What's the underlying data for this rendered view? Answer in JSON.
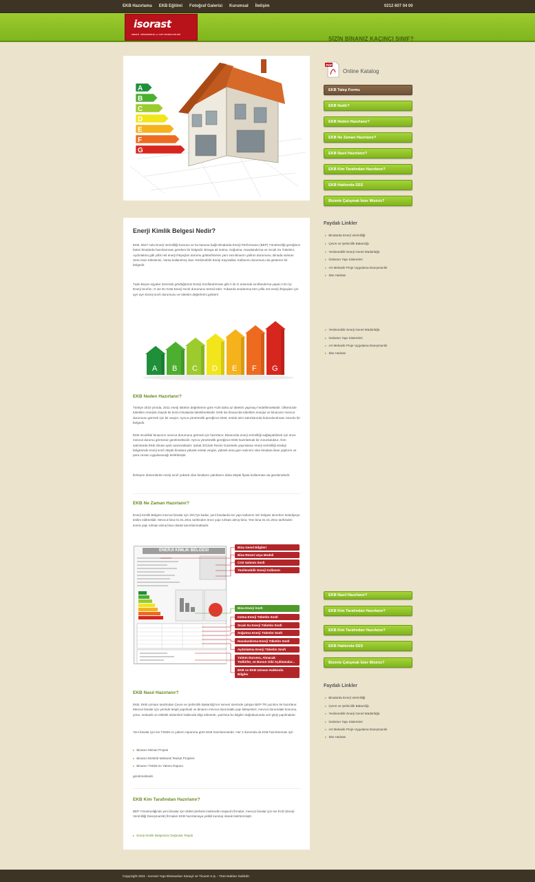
{
  "topbar": {
    "nav": [
      "EKB Hazırlama",
      "EKB Eğitimi",
      "Fotoğraf Galerisi",
      "Kurumsal",
      "İletişim"
    ],
    "phone": "0212 607 04 00"
  },
  "header": {
    "logo": "isorast",
    "logo_sub": "ENERJİ - MÜHENDİSLİK ve YAPI TEKNOLOJİLERİ",
    "tagline": "SİZİN BİNANIZ KAÇINCI SINIF?"
  },
  "hero": {
    "classes": [
      "A",
      "B",
      "C",
      "D",
      "E",
      "F",
      "G"
    ],
    "colors": [
      "#1f8f3a",
      "#4caf2f",
      "#9ccb2e",
      "#f2e51b",
      "#f5b21b",
      "#ee6a1f",
      "#d7261e"
    ]
  },
  "article": {
    "title": "Enerji Kimlik Belgesi Nedir?",
    "p1": "EKB, 5627 nolu Enerji Verimliliği Kanunu ve bu kanuna bağlı Binalarda Enerji Performansı (BEP) Yönetmeliği gereğince bütün binalarda hazırlanması gereken bir belgedir. Binaya ait Isıtma, Soğutma, Havalandırma ve Sıcak Su Tüketimi, Aydınlatma gibi yıllık net enerji ihtiyaçları durumu gösterilmenin yanı sıra Binanın yalıtım durumunu, Binada salınan Sera Gazı tüketimini, Varsa kullanılmış olan Yenilenebilir Enerji Kaynakları Kullanımı durumunu da gösteren bir belgedir.",
    "p2": "Tıpkı Beyaz eşyalar üzerinde gördüğümüz Enerji Sınıflandırması gibi A ile G arasında sınıflandırma yapar.A En İyi Enerji Sınıfını; G ise En Kötü Enerji Sınıfı durumunu temsil eder. Yukarıda sıralanmış tüm yıllık net enerji ihtiyaçları için ayrı ayrı Enerji sınıfı durumunu ve tüketim değerlerini gösterir",
    "houses": [
      "A",
      "B",
      "C",
      "D",
      "E",
      "F",
      "G"
    ],
    "house_colors": [
      "#1f8f3a",
      "#4caf2f",
      "#9ccb2e",
      "#f2e51b",
      "#f5b21b",
      "#ee6a1f",
      "#d7261e"
    ],
    "s1_title": "EKB Neden Hazırlanır?",
    "s1_p1": "Türkiye 2023 yılında, 2011 enerji tüketim değerlerine göre %20 daha az tüketim yapmayı hedeflemektedir. Ülkemizde tüketilen enerjinin büyük bir kısmı binalarda tüketilmektedir. EKB ise binanızda tüketilen enerjiyi ve binanızın mevcut durumunu görmek için bir araçtır. Ayrıca yönetmelik gereğince EKB, emlak alım satımlarında bulundurulması zorunlu bir belgedir.",
    "s1_p2": "EKB öncelikle binanızın mevcut durumunu görmek için hazırlanır. Binanızda enerji verimliliği sağlayabilmek için önce mevcut durumu görmeniz gerekmektedir. Ayrıca yönetmelik gereğince EKB hazırlatmak bir zorunluluktur. Alım satımlarda EKB olması şartı aranmaktadır. Şubat 2012de Resmi Gazetede yayınlanan enerji verimliliği strateji belgesinde enerji sınıfı düşük binalara yüksek emlak vergisi, yüksek sera gazı salınımı olan binalara ilave yaptırım ve para cezası uygulanacağı belirtilmiştir.",
    "s1_p3": "İlerleyen dönemlerde enerji sınıfı yüksek olan binaların yakıtlarını daha düşük fiyata kullanması da gündemdedir.",
    "s2_title": "EKB Ne Zaman Hazırlanır?",
    "s2_p1": "Enerji Kimlik Belgesi mevcut binalar için 2017ye kadar, yeni binalarda ise yapı kullanım izin belgesi alınırken belediyeye teslim edilmelidir. Mevcut bina 01.01.2011 tarihinden önce yapı ruhsatı almış bina; Yeni bina 01.01.2011 tarihinden sonra yapı ruhsatı almış bina olarak tanımlanmaktadır.",
    "cert_title": "ENERJİ KİMLİK BELGESİ",
    "cert_labels": [
      "Bina Genel Bilgileri",
      "Bina Resmi veya Modeli",
      "CO2 Salınım Sınıfı",
      "Yenilenebilir Enerji Kullanım Oranı",
      "Bina Enerji Sınıfı",
      "Isıtma Enerji Tüketim Sınıfı",
      "Sıcak Su Enerji Tüketim Sınıfı",
      "Soğutma Enerji Tüketim Sınıfı",
      "Havalandırma Enerji Tüketim Sınıfı",
      "Aydınlatma Enerji Tüketim Sınıfı",
      "Yalıtım Durumu, Alınacak Tedbirler, ve Bunun Gibi Açıklamalar...",
      "EKB ve EKB Uzmanı Hakkında Bilgiler"
    ],
    "s3_title": "EKB Nasıl Hazırlanır?",
    "s3_p1": "EKB, EKB uzmanı tarafından Çevre ve Şehircilik Bakanlığı'nın serveri üzerinde çalışan BEP-TR yazılımı ile hazırlanır. Mevcut binalar için yerinde tespit yapılmalı ve binanın mevcut durumdaki yapı bileşenleri, mevcut durumdaki konumu, yönü, mekanik ve elektrik sistemleri hakkında bilgi edinerek, yazılıma bu bilgiler doğrultusunda veri girişi yapılmalıdır.",
    "s3_p2": "Yeni binalar için ise TS825 ısı yalıtım raporuna göre EKB hazırlanmalıdır. Her 2 durumda da EKB hazırlanması için",
    "s3_bullets": [
      "Binanın Mimari Projesi",
      "Binanın Elektrik-Mekanik Tesisat Projeleri",
      "Binanın TS825 Isı Yalıtım Raporu"
    ],
    "s3_p3": "gerekmektedir.",
    "s4_title": "EKB Kim Tarafından Hazırlanır?",
    "s4_p1": "BEP Yönetmeliğinde yeni binalar için SMM (serbest mühendis müşavir) firmalar; mevcut binalar için ise EVD (Enerji Verimliliği Danışmanlık) firmaları EKB hazırlamaya yetkili kuruluş olarak belirlenmiştir.",
    "s4_link": "Enerji Kimlik Belgenizin Doğruluk Tespiti"
  },
  "sidebar": {
    "catalog": "Online Katalog",
    "pdf": "PDF",
    "buttons": [
      "EKB Talep Formu",
      "EKB Nedir?",
      "EKB Neden Hazırlanır?",
      "EKB Ne Zaman Hazırlanır?",
      "EKB Nasıl Hazırlanır?",
      "EKB Kim Tarafından Hazırlanır?",
      "EKB Hakkında SSS",
      "Bizimle Çalışmak İster Misiniz?"
    ],
    "links_title": "Faydalı Linkler",
    "links": [
      "Binalarda Enerji Verimliliği",
      "Çevre ve Şehircilik Bakanlığı",
      "Yenilenebilir Enerji Genel Müdürlüğü",
      "İzobeton Yapı Sistemleri",
      "Art Mekanik Proje Uygulama Danışmanlık",
      "Site Haritası"
    ],
    "ghost_links": [
      "Yenilenebilir Enerji Genel Müdürlüğü",
      "İzobeton Yapı Sistemleri",
      "Art Mekanik Proje Uygulama Danışmanlık",
      "Site Haritası"
    ],
    "buttons2": [
      "EKB Nasıl Hazırlanır?",
      "EKB Kim Tarafından Hazırlanır?",
      "EKB Kim Tarafından Hazırlanır?",
      "EKB Hakkında SSS",
      "Bizimle Çalışmak İster Misiniz?"
    ],
    "links2_title": "Faydalı Linkler",
    "links2": [
      "Binalarda Enerji Verimliliği",
      "Çevre ve Şehircilik Bakanlığı",
      "Yenilenebilir Enerji Genel Müdürlüğü",
      "İzobeton Yapı Sistemleri",
      "Art Mekanik Proje Uygulama Danışmanlık",
      "Site Haritası"
    ]
  },
  "footer": {
    "copyright": "Copyright 2011 - Isorast Yapı Elemanları Sanayi ve Ticaret A.Ş. - Tüm Hakları Saklıdır"
  }
}
